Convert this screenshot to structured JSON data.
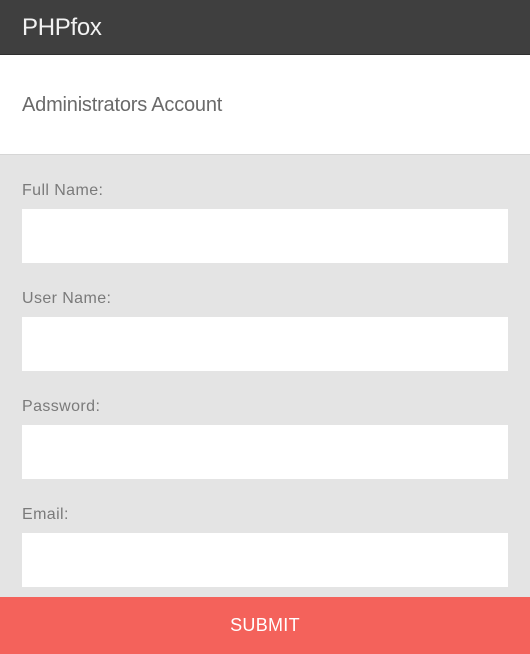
{
  "header": {
    "brand": "PHPfox"
  },
  "page": {
    "title": "Administrators Account"
  },
  "form": {
    "fields": [
      {
        "label": "Full Name:",
        "value": "",
        "placeholder": ""
      },
      {
        "label": "User Name:",
        "value": "",
        "placeholder": ""
      },
      {
        "label": "Password:",
        "value": "",
        "placeholder": ""
      },
      {
        "label": "Email:",
        "value": "",
        "placeholder": ""
      }
    ],
    "submit_label": "SUBMIT"
  },
  "colors": {
    "header_bg": "#3f3f3f",
    "form_bg": "#e4e4e4",
    "submit_bg": "#f4625b"
  }
}
